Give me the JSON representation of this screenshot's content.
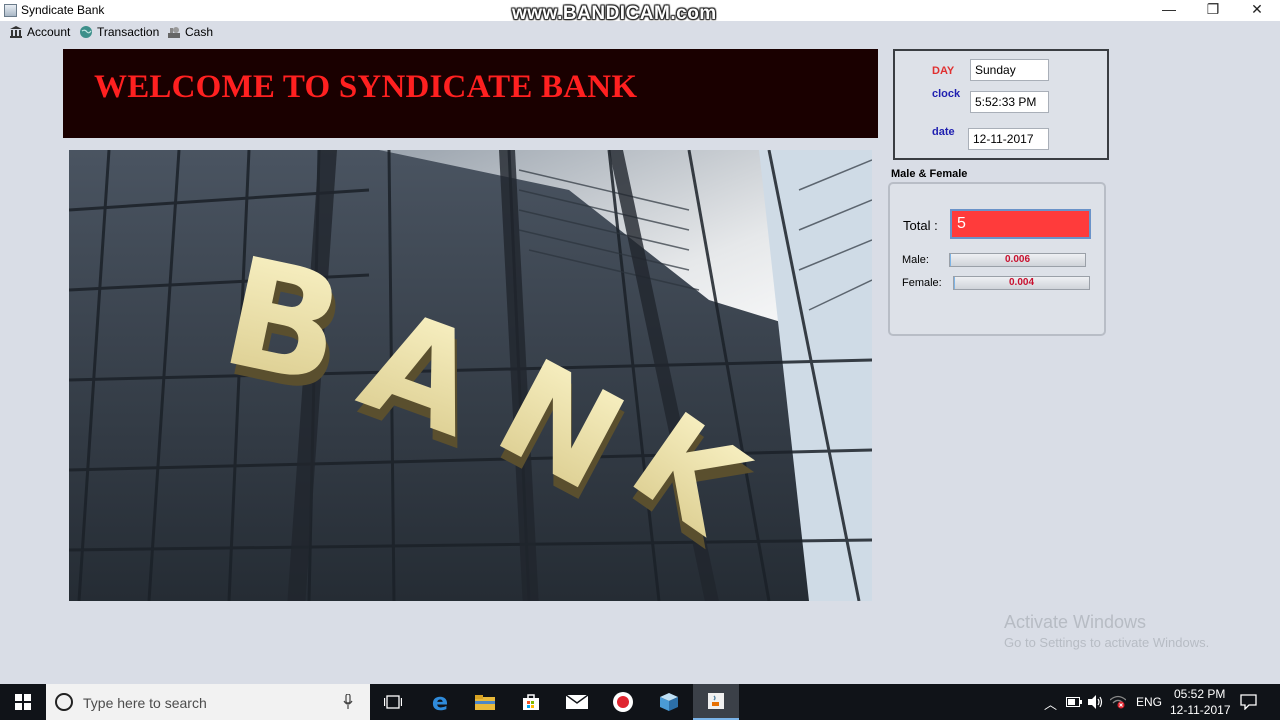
{
  "window": {
    "title": "Syndicate Bank",
    "watermark": "www.BANDICAM.com",
    "minimize": "—",
    "restore": "❐",
    "close": "✕"
  },
  "menu": [
    {
      "label": "Account",
      "icon": "bank-icon"
    },
    {
      "label": "Transaction",
      "icon": "globe-icon"
    },
    {
      "label": "Cash",
      "icon": "cash-icon"
    }
  ],
  "welcome": {
    "text": "WELCOME TO SYNDICATE BANK"
  },
  "bank_image": {
    "label": "BANK"
  },
  "info": {
    "day_label": "DAY",
    "day_value": "Sunday",
    "clock_label": "clock",
    "clock_value": "5:52:33 PM",
    "date_label": "date",
    "date_value": "12-11-2017"
  },
  "male_female": {
    "title": "Male & Female",
    "total_label": "Total :",
    "total_value": "5",
    "male_label": "Male:",
    "male_value": "0.006",
    "male_fraction": 0.006,
    "female_label": "Female:",
    "female_value": "0.004",
    "female_fraction": 0.004
  },
  "activate_windows": {
    "line1": "Activate Windows",
    "line2": "Go to Settings to activate Windows."
  },
  "taskbar": {
    "search_placeholder": "Type here to search",
    "language": "ENG",
    "time": "05:52 PM",
    "date": "12-11-2017"
  },
  "colors": {
    "welcome_bg": "#1a0000",
    "welcome_text": "#ff2020",
    "total_bg": "#ff3b3b",
    "day_label": "#e03030",
    "clock_label": "#1f1fb0"
  }
}
